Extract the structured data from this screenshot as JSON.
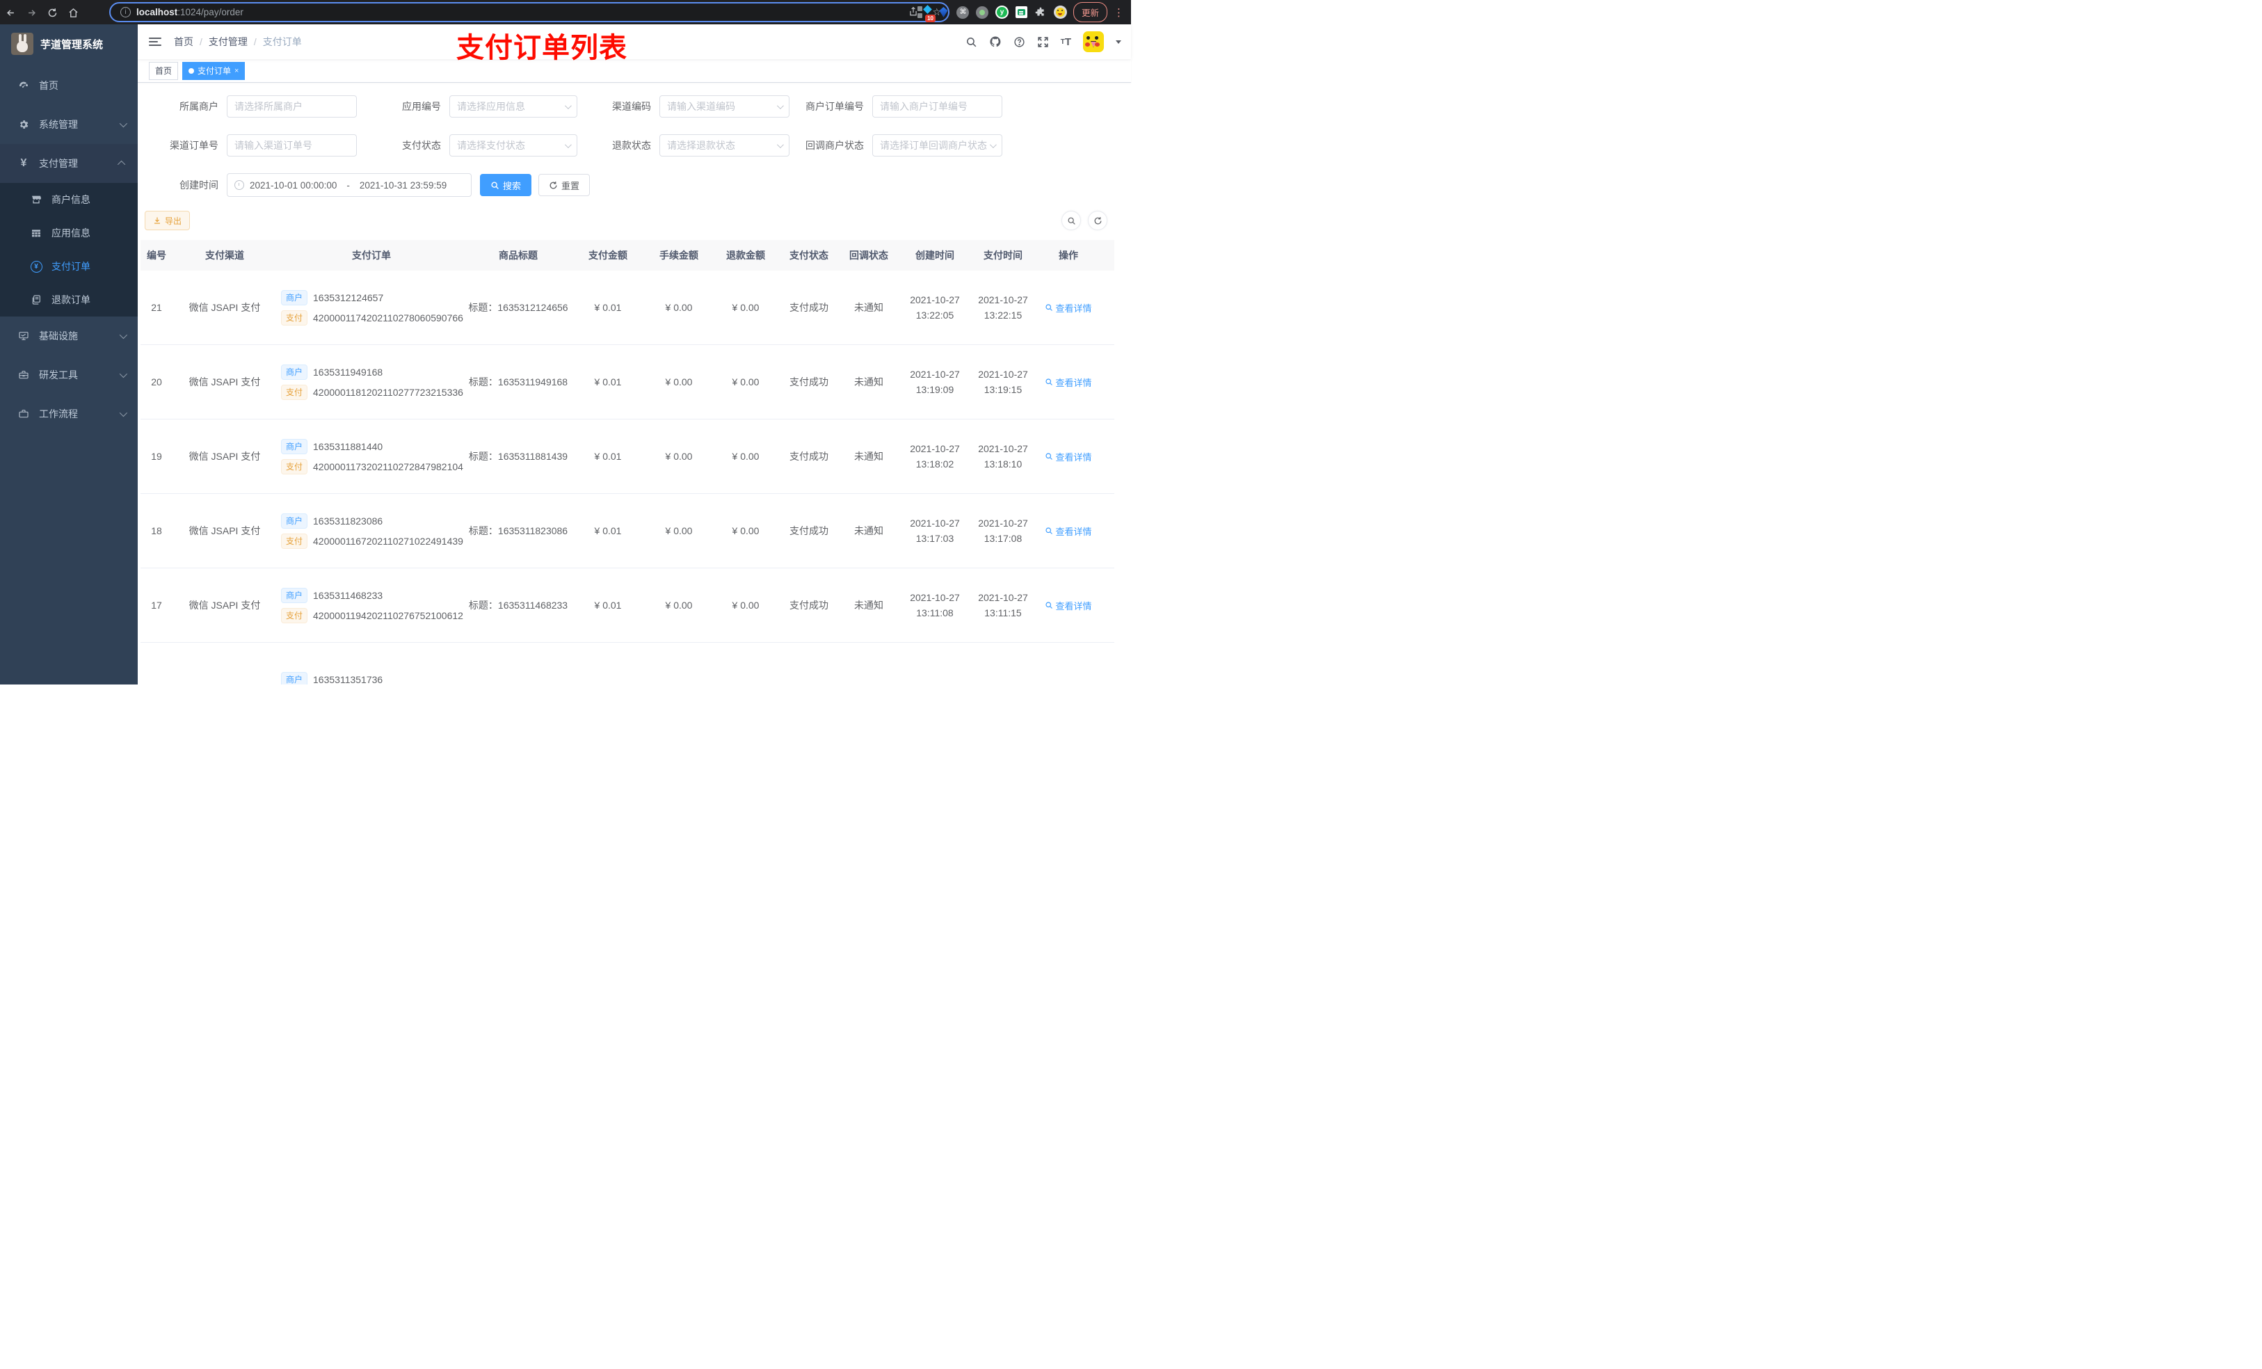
{
  "browser": {
    "url_host": "localhost",
    "url_rest": ":1024/pay/order",
    "ext_badge": "10",
    "update_label": "更新"
  },
  "sidebar": {
    "title": "芋道管理系统",
    "items": [
      {
        "label": "首页",
        "icon": "dashboard-icon"
      },
      {
        "label": "系统管理",
        "icon": "gear-icon",
        "chevron": "down"
      },
      {
        "label": "支付管理",
        "icon": "yen-icon",
        "chevron": "up",
        "expanded": true,
        "children": [
          {
            "label": "商户信息",
            "icon": "shop-icon"
          },
          {
            "label": "应用信息",
            "icon": "grid-icon"
          },
          {
            "label": "支付订单",
            "icon": "yen-circle-icon",
            "active": true
          },
          {
            "label": "退款订单",
            "icon": "docs-icon"
          }
        ]
      },
      {
        "label": "基础设施",
        "icon": "monitor-icon",
        "chevron": "down"
      },
      {
        "label": "研发工具",
        "icon": "toolbox-icon",
        "chevron": "down"
      },
      {
        "label": "工作流程",
        "icon": "briefcase-icon",
        "chevron": "down"
      }
    ]
  },
  "header": {
    "breadcrumb": [
      "首页",
      "支付管理",
      "支付订单"
    ],
    "annotation": "支付订单列表",
    "annotation_color": "#fe0b00"
  },
  "tabs": [
    {
      "label": "首页",
      "active": false
    },
    {
      "label": "支付订单",
      "active": true,
      "closable": true
    }
  ],
  "filters": {
    "rows": [
      [
        {
          "label": "所属商户",
          "placeholder": "请选择所属商户",
          "type": "input"
        },
        {
          "label": "应用编号",
          "placeholder": "请选择应用信息",
          "type": "select"
        },
        {
          "label": "渠道编码",
          "placeholder": "请输入渠道编码",
          "type": "select"
        },
        {
          "label": "商户订单编号",
          "placeholder": "请输入商户订单编号",
          "type": "input"
        }
      ],
      [
        {
          "label": "渠道订单号",
          "placeholder": "请输入渠道订单号",
          "type": "input"
        },
        {
          "label": "支付状态",
          "placeholder": "请选择支付状态",
          "type": "select"
        },
        {
          "label": "退款状态",
          "placeholder": "请选择退款状态",
          "type": "select"
        },
        {
          "label": "回调商户状态",
          "placeholder": "请选择订单回调商户状态",
          "type": "select"
        }
      ]
    ],
    "date": {
      "label": "创建时间",
      "start": "2021-10-01 00:00:00",
      "end": "2021-10-31 23:59:59",
      "separator": "-"
    },
    "search_label": "搜索",
    "reset_label": "重置"
  },
  "toolbar": {
    "export_label": "导出"
  },
  "table": {
    "columns": [
      "编号",
      "支付渠道",
      "支付订单",
      "商品标题",
      "支付金额",
      "手续金额",
      "退款金额",
      "支付状态",
      "回调状态",
      "创建时间",
      "支付时间",
      "操作"
    ],
    "tag_merchant": "商户",
    "tag_pay": "支付",
    "title_prefix": "标题：",
    "action_label": "查看详情",
    "rows": [
      {
        "id": "21",
        "channel": "微信 JSAPI 支付",
        "merchant_no": "1635312124657",
        "pay_no": "4200001174202110278060590766",
        "title": "1635312124656",
        "amount": "¥ 0.01",
        "fee": "¥ 0.00",
        "refund": "¥ 0.00",
        "status": "支付成功",
        "notify": "未通知",
        "created_date": "2021-10-27",
        "created_time": "13:22:05",
        "paid_date": "2021-10-27",
        "paid_time": "13:22:15"
      },
      {
        "id": "20",
        "channel": "微信 JSAPI 支付",
        "merchant_no": "1635311949168",
        "pay_no": "4200001181202110277723215336",
        "title": "1635311949168",
        "amount": "¥ 0.01",
        "fee": "¥ 0.00",
        "refund": "¥ 0.00",
        "status": "支付成功",
        "notify": "未通知",
        "created_date": "2021-10-27",
        "created_time": "13:19:09",
        "paid_date": "2021-10-27",
        "paid_time": "13:19:15"
      },
      {
        "id": "19",
        "channel": "微信 JSAPI 支付",
        "merchant_no": "1635311881440",
        "pay_no": "4200001173202110272847982104",
        "title": "1635311881439",
        "amount": "¥ 0.01",
        "fee": "¥ 0.00",
        "refund": "¥ 0.00",
        "status": "支付成功",
        "notify": "未通知",
        "created_date": "2021-10-27",
        "created_time": "13:18:02",
        "paid_date": "2021-10-27",
        "paid_time": "13:18:10"
      },
      {
        "id": "18",
        "channel": "微信 JSAPI 支付",
        "merchant_no": "1635311823086",
        "pay_no": "4200001167202110271022491439",
        "title": "1635311823086",
        "amount": "¥ 0.01",
        "fee": "¥ 0.00",
        "refund": "¥ 0.00",
        "status": "支付成功",
        "notify": "未通知",
        "created_date": "2021-10-27",
        "created_time": "13:17:03",
        "paid_date": "2021-10-27",
        "paid_time": "13:17:08"
      },
      {
        "id": "17",
        "channel": "微信 JSAPI 支付",
        "merchant_no": "1635311468233",
        "pay_no": "4200001194202110276752100612",
        "title": "1635311468233",
        "amount": "¥ 0.01",
        "fee": "¥ 0.00",
        "refund": "¥ 0.00",
        "status": "支付成功",
        "notify": "未通知",
        "created_date": "2021-10-27",
        "created_time": "13:11:08",
        "paid_date": "2021-10-27",
        "paid_time": "13:11:15"
      }
    ],
    "partial_row": {
      "merchant_no": "1635311351736"
    }
  },
  "colors": {
    "accent": "#409eff",
    "warning": "#e6a23c",
    "sidebar": "#304156",
    "submenu": "#1f2d3d"
  }
}
